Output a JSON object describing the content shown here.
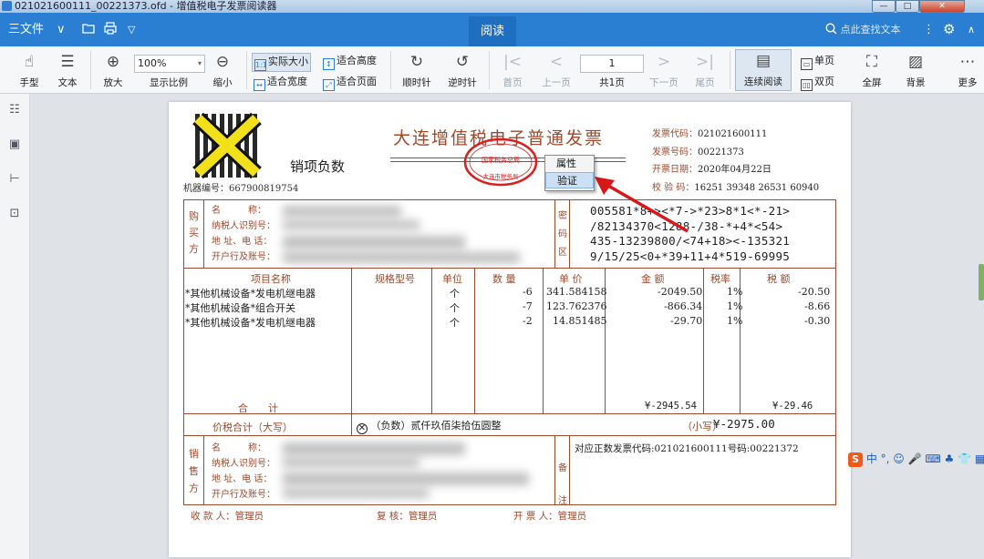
{
  "window": {
    "title": "021021600111_00221373.ofd - 增值税电子发票阅读器",
    "min": "—",
    "max": "□",
    "close": "✕"
  },
  "menu": {
    "file": "三文件",
    "dd": "∨",
    "folder_icon": "folder-icon",
    "print_icon": "printer-icon",
    "more": "▽",
    "tab": "阅读",
    "search": "点此查找文本",
    "more_icon": "⋮",
    "settings_icon": "⚙",
    "collapse": "∧"
  },
  "toolbar": {
    "hand": "手型",
    "text": "文本",
    "zoom_in": "放大",
    "zoom_value": "100%",
    "ratio": "显示比例",
    "zoom_out": "缩小",
    "actual": "实际大小",
    "fit_w": "适合宽度",
    "fit_h": "适合高度",
    "fit_p": "适合页面",
    "cw": "顺时针",
    "ccw": "逆时针",
    "first": "首页",
    "prev": "上一页",
    "page": "1",
    "total": "共1页",
    "next": "下一页",
    "last": "尾页",
    "cont": "连续阅读",
    "single": "单页",
    "double": "双页",
    "full": "全屏",
    "bg": "背景",
    "more": "更多"
  },
  "invoice": {
    "title": "大连增值税电子普通发票",
    "subtitle": "销项负数",
    "machine": "机器编号：667900819754",
    "code_label": "发票代码：",
    "code": "021021600111",
    "no_label": "发票号码：",
    "no": "00221373",
    "date_label": "开票日期：",
    "date": "2020年04月22日",
    "check_label": "校 验 码：",
    "check": "16251 39348 26531 60940",
    "buyer": {
      "side": [
        "购",
        "买",
        "方"
      ],
      "name": "名　　　称：",
      "tax": "纳税人识别号：",
      "addr": "地 址、电 话：",
      "bank": "开户行及账号："
    },
    "cipher_side": [
      "密",
      "码",
      "区"
    ],
    "cipher": [
      "005581*8+><*7->*23>8*1<*-21>",
      "/82134370<1288-/38-*+4*<54>",
      "435-13239800/<74+18><-135321",
      "9/15/25<0+*39+11+4*519-69995"
    ],
    "cols": [
      "项目名称",
      "规格型号",
      "单位",
      "数 量",
      "单 价",
      "金 额",
      "税率",
      "税 额"
    ],
    "items": [
      {
        "name": "*其他机械设备*发电机继电器",
        "unit": "个",
        "qty": "-6",
        "price": "341.584158",
        "amount": "-2049.50",
        "rate": "1%",
        "tax": "-20.50"
      },
      {
        "name": "*其他机械设备*组合开关",
        "unit": "个",
        "qty": "-7",
        "price": "123.762376",
        "amount": "-866.34",
        "rate": "1%",
        "tax": "-8.66"
      },
      {
        "name": "*其他机械设备*发电机继电器",
        "unit": "个",
        "qty": "-2",
        "price": "14.851485",
        "amount": "-29.70",
        "rate": "1%",
        "tax": "-0.30"
      }
    ],
    "total_label": "合　　计",
    "total_amount": "¥-2945.54",
    "total_tax": "¥-29.46",
    "words_label": "价税合计（大写）",
    "words": "（负数）贰仟玖佰柒拾伍圆整",
    "small_label": "（小写）",
    "small": "¥-2975.00",
    "seller": {
      "side": [
        "销",
        "售",
        "方"
      ],
      "name": "名　　　称：",
      "tax": "纳税人识别号：",
      "addr": "地 址、电 话：",
      "bank": "开户行及账号："
    },
    "remark_side": [
      "备",
      "注"
    ],
    "remark": "对应正数发票代码:021021600111号码:00221372",
    "payee": "收 款 人：管理员",
    "reviewer": "复 核：管理员",
    "drawer": "开 票 人：管理员",
    "seal_top": "国家税务总局",
    "seal_bottom": "大连市税务局"
  },
  "context_menu": {
    "props": "属性",
    "verify": "验证"
  },
  "ime": "中 °, ☺ 🎤 ⌨ ♣ 👕 ▦"
}
